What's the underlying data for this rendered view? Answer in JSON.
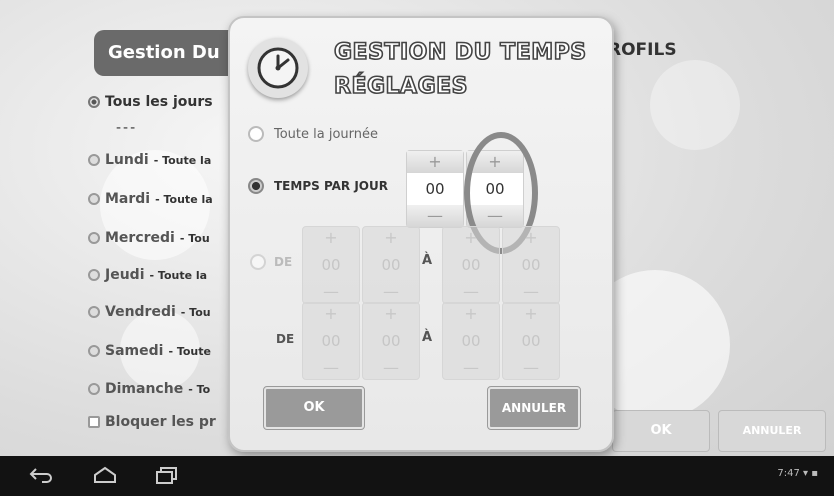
{
  "background": {
    "title": "Gestion Du",
    "profiles_label": "ROFILS",
    "all_days": "Tous les jours",
    "separator": "---",
    "days": [
      {
        "name": "Lundi",
        "detail": "- Toute la"
      },
      {
        "name": "Mardi",
        "detail": "- Toute la"
      },
      {
        "name": "Mercredi",
        "detail": "- Tou"
      },
      {
        "name": "Jeudi",
        "detail": "- Toute la"
      },
      {
        "name": "Vendredi",
        "detail": "- Tou"
      },
      {
        "name": "Samedi",
        "detail": "- Toute"
      },
      {
        "name": "Dimanche",
        "detail": "- To"
      }
    ],
    "block_label": "Bloquer les pr",
    "ok_label": "OK",
    "cancel_label": "ANNULER"
  },
  "dialog": {
    "icon": "clock-icon",
    "title_line1": "GESTION DU TEMPS",
    "title_line2": "RÉGLAGES",
    "option_all_day": "Toute la journée",
    "option_time_per_day": "TEMPS PAR JOUR",
    "time_per_day": {
      "hours": "00",
      "minutes": "00",
      "plus": "+",
      "minus": "—"
    },
    "range_rows": [
      {
        "label": "DE",
        "from_h": "00",
        "from_m": "00",
        "to_label": "À",
        "to_h": "00",
        "to_m": "00"
      },
      {
        "label": "DE",
        "from_h": "00",
        "from_m": "00",
        "to_label": "À",
        "to_h": "00",
        "to_m": "00"
      }
    ],
    "ok_label": "OK",
    "cancel_label": "ANNULER"
  },
  "status_bar": {
    "time": "7:47"
  },
  "colors": {
    "nav_bar": "#121212",
    "title_bar": "#6a6a6a",
    "button": "#9a9a9a"
  }
}
